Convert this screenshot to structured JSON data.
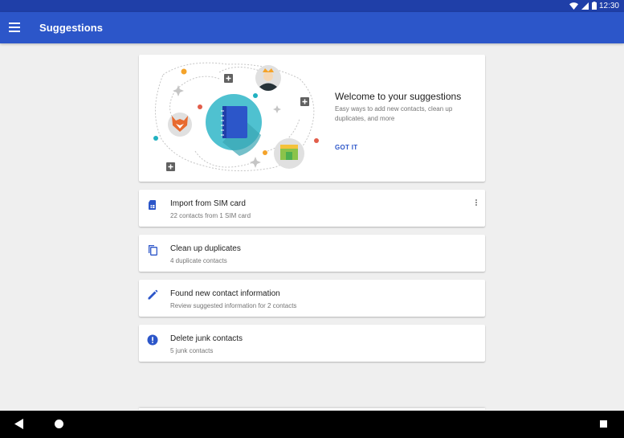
{
  "status_bar": {
    "time": "12:30",
    "icons": [
      "wifi-icon",
      "signal-icon",
      "battery-icon"
    ]
  },
  "app_bar": {
    "title": "Suggestions",
    "menu_icon": "menu-icon"
  },
  "welcome_card": {
    "title": "Welcome to your suggestions",
    "description": "Easy ways to add new contacts, clean up duplicates, and more",
    "action_label": "GOT IT"
  },
  "suggestions": [
    {
      "icon": "sim-card-icon",
      "title": "Import from SIM card",
      "subtitle": "22 contacts from 1 SIM card",
      "has_more": true
    },
    {
      "icon": "copy-icon",
      "title": "Clean up duplicates",
      "subtitle": "4 duplicate contacts",
      "has_more": false
    },
    {
      "icon": "pencil-icon",
      "title": "Found new contact information",
      "subtitle": "Review suggested information for 2 contacts",
      "has_more": false
    },
    {
      "icon": "alert-icon",
      "title": "Delete junk contacts",
      "subtitle": "5 junk contacts",
      "has_more": false
    }
  ],
  "nav_bar": {
    "icons": [
      "back-icon",
      "home-icon",
      "recents-icon"
    ]
  },
  "colors": {
    "status_bar": "#1f3fa8",
    "app_bar": "#2c56c9",
    "accent": "#2c56c9",
    "background": "#efefef"
  }
}
